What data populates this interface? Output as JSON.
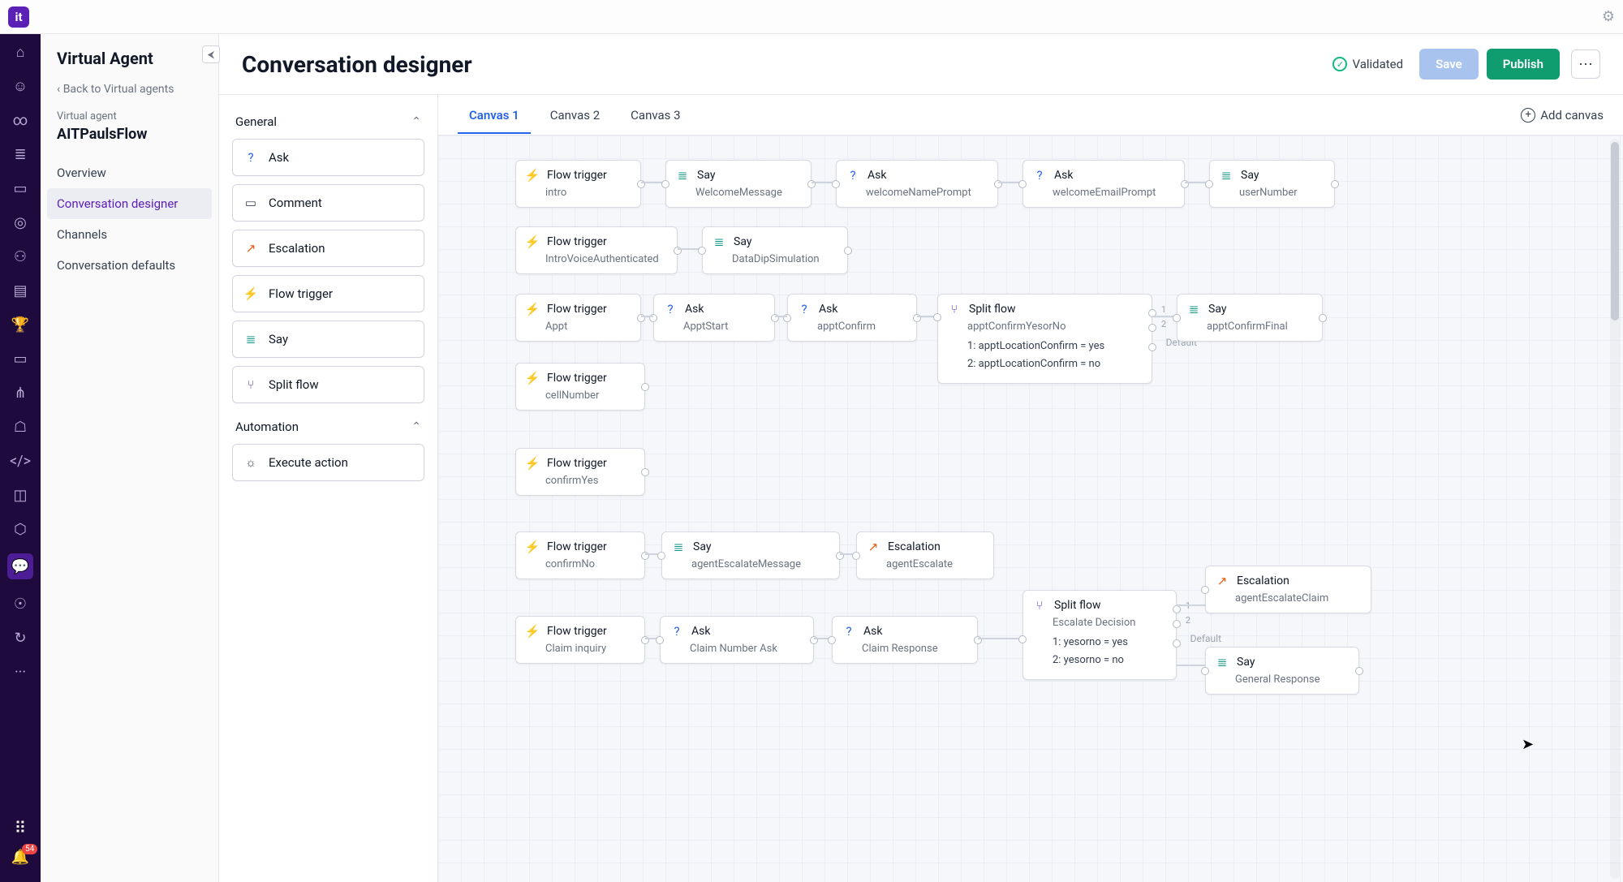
{
  "window": {
    "logo_letter": "it"
  },
  "rail": {
    "items": [
      "home",
      "user",
      "link",
      "bars",
      "id",
      "target",
      "people",
      "clipboard",
      "trophy",
      "book",
      "fork",
      "shield",
      "code",
      "chip",
      "puzzle",
      "chat-active",
      "eye",
      "arrow"
    ],
    "more": "···",
    "notif_badge": "54"
  },
  "sidepanel": {
    "title": "Virtual Agent",
    "back": "Back to Virtual agents",
    "sub_label": "Virtual agent",
    "flow_name": "AITPaulsFlow",
    "items": [
      {
        "label": "Overview",
        "active": false
      },
      {
        "label": "Conversation designer",
        "active": true
      },
      {
        "label": "Channels",
        "active": false
      },
      {
        "label": "Conversation defaults",
        "active": false
      }
    ]
  },
  "header": {
    "title": "Conversation designer",
    "validated": "Validated",
    "save": "Save",
    "publish": "Publish"
  },
  "palette": {
    "sections": [
      {
        "title": "General",
        "items": [
          {
            "icon": "ask",
            "label": "Ask"
          },
          {
            "icon": "comment",
            "label": "Comment"
          },
          {
            "icon": "esc",
            "label": "Escalation"
          },
          {
            "icon": "flow",
            "label": "Flow trigger"
          },
          {
            "icon": "say",
            "label": "Say"
          },
          {
            "icon": "split",
            "label": "Split flow"
          }
        ]
      },
      {
        "title": "Automation",
        "items": [
          {
            "icon": "exec",
            "label": "Execute action"
          }
        ]
      }
    ]
  },
  "tabs": {
    "items": [
      {
        "label": "Canvas 1",
        "active": true
      },
      {
        "label": "Canvas 2",
        "active": false
      },
      {
        "label": "Canvas 3",
        "active": false
      }
    ],
    "add": "Add canvas"
  },
  "nodes": {
    "r1": {
      "ft": {
        "type": "Flow trigger",
        "sub": "intro"
      },
      "say1": {
        "type": "Say",
        "sub": "WelcomeMessage"
      },
      "ask1": {
        "type": "Ask",
        "sub": "welcomeNamePrompt"
      },
      "ask2": {
        "type": "Ask",
        "sub": "welcomeEmailPrompt"
      },
      "say2": {
        "type": "Say",
        "sub": "userNumber"
      }
    },
    "r2": {
      "ft": {
        "type": "Flow trigger",
        "sub": "IntroVoiceAuthenticated"
      },
      "say": {
        "type": "Say",
        "sub": "DataDipSimulation"
      }
    },
    "r3": {
      "ft": {
        "type": "Flow trigger",
        "sub": "Appt"
      },
      "ask1": {
        "type": "Ask",
        "sub": "ApptStart"
      },
      "ask2": {
        "type": "Ask",
        "sub": "apptConfirm"
      },
      "split": {
        "type": "Split flow",
        "sub": "apptConfirmYesorNo",
        "c1": "1: apptLocationConfirm = yes",
        "c2": "2: apptLocationConfirm = no",
        "default": "Default"
      },
      "say": {
        "type": "Say",
        "sub": "apptConfirmFinal"
      }
    },
    "r4": {
      "ft": {
        "type": "Flow trigger",
        "sub": "cellNumber"
      }
    },
    "r5": {
      "ft": {
        "type": "Flow trigger",
        "sub": "confirmYes"
      }
    },
    "r6": {
      "ft": {
        "type": "Flow trigger",
        "sub": "confirmNo"
      },
      "say": {
        "type": "Say",
        "sub": "agentEscalateMessage"
      },
      "esc": {
        "type": "Escalation",
        "sub": "agentEscalate"
      }
    },
    "r7": {
      "ft": {
        "type": "Flow trigger",
        "sub": "Claim inquiry"
      },
      "ask1": {
        "type": "Ask",
        "sub": "Claim Number Ask"
      },
      "ask2": {
        "type": "Ask",
        "sub": "Claim Response"
      },
      "split": {
        "type": "Split flow",
        "sub": "Escalate Decision",
        "c1": "1: yesorno = yes",
        "c2": "2: yesorno = no",
        "default": "Default"
      },
      "esc": {
        "type": "Escalation",
        "sub": "agentEscalateClaim"
      },
      "say": {
        "type": "Say",
        "sub": "General Response"
      }
    }
  }
}
